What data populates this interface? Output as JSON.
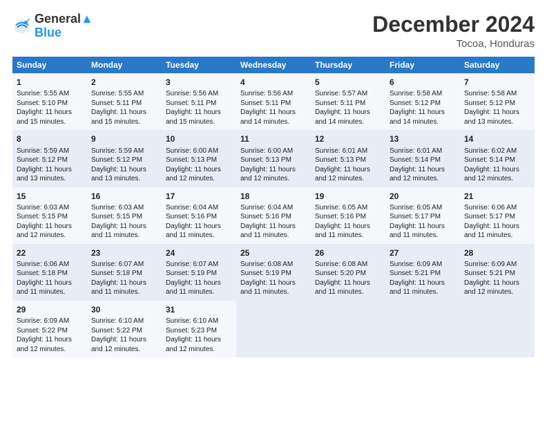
{
  "logo": {
    "line1": "General",
    "line2": "Blue"
  },
  "title": "December 2024",
  "subtitle": "Tocoa, Honduras",
  "columns": [
    "Sunday",
    "Monday",
    "Tuesday",
    "Wednesday",
    "Thursday",
    "Friday",
    "Saturday"
  ],
  "weeks": [
    [
      {
        "day": 1,
        "rise": "5:55 AM",
        "set": "5:10 PM",
        "daylight": "11 hours and 15 minutes."
      },
      {
        "day": 2,
        "rise": "5:55 AM",
        "set": "5:11 PM",
        "daylight": "11 hours and 15 minutes."
      },
      {
        "day": 3,
        "rise": "5:56 AM",
        "set": "5:11 PM",
        "daylight": "11 hours and 15 minutes."
      },
      {
        "day": 4,
        "rise": "5:56 AM",
        "set": "5:11 PM",
        "daylight": "11 hours and 14 minutes."
      },
      {
        "day": 5,
        "rise": "5:57 AM",
        "set": "5:11 PM",
        "daylight": "11 hours and 14 minutes."
      },
      {
        "day": 6,
        "rise": "5:58 AM",
        "set": "5:12 PM",
        "daylight": "11 hours and 14 minutes."
      },
      {
        "day": 7,
        "rise": "5:58 AM",
        "set": "5:12 PM",
        "daylight": "11 hours and 13 minutes."
      }
    ],
    [
      {
        "day": 8,
        "rise": "5:59 AM",
        "set": "5:12 PM",
        "daylight": "11 hours and 13 minutes."
      },
      {
        "day": 9,
        "rise": "5:59 AM",
        "set": "5:12 PM",
        "daylight": "11 hours and 13 minutes."
      },
      {
        "day": 10,
        "rise": "6:00 AM",
        "set": "5:13 PM",
        "daylight": "11 hours and 12 minutes."
      },
      {
        "day": 11,
        "rise": "6:00 AM",
        "set": "5:13 PM",
        "daylight": "11 hours and 12 minutes."
      },
      {
        "day": 12,
        "rise": "6:01 AM",
        "set": "5:13 PM",
        "daylight": "11 hours and 12 minutes."
      },
      {
        "day": 13,
        "rise": "6:01 AM",
        "set": "5:14 PM",
        "daylight": "11 hours and 12 minutes."
      },
      {
        "day": 14,
        "rise": "6:02 AM",
        "set": "5:14 PM",
        "daylight": "11 hours and 12 minutes."
      }
    ],
    [
      {
        "day": 15,
        "rise": "6:03 AM",
        "set": "5:15 PM",
        "daylight": "11 hours and 12 minutes."
      },
      {
        "day": 16,
        "rise": "6:03 AM",
        "set": "5:15 PM",
        "daylight": "11 hours and 11 minutes."
      },
      {
        "day": 17,
        "rise": "6:04 AM",
        "set": "5:16 PM",
        "daylight": "11 hours and 11 minutes."
      },
      {
        "day": 18,
        "rise": "6:04 AM",
        "set": "5:16 PM",
        "daylight": "11 hours and 11 minutes."
      },
      {
        "day": 19,
        "rise": "6:05 AM",
        "set": "5:16 PM",
        "daylight": "11 hours and 11 minutes."
      },
      {
        "day": 20,
        "rise": "6:05 AM",
        "set": "5:17 PM",
        "daylight": "11 hours and 11 minutes."
      },
      {
        "day": 21,
        "rise": "6:06 AM",
        "set": "5:17 PM",
        "daylight": "11 hours and 11 minutes."
      }
    ],
    [
      {
        "day": 22,
        "rise": "6:06 AM",
        "set": "5:18 PM",
        "daylight": "11 hours and 11 minutes."
      },
      {
        "day": 23,
        "rise": "6:07 AM",
        "set": "5:18 PM",
        "daylight": "11 hours and 11 minutes."
      },
      {
        "day": 24,
        "rise": "6:07 AM",
        "set": "5:19 PM",
        "daylight": "11 hours and 11 minutes."
      },
      {
        "day": 25,
        "rise": "6:08 AM",
        "set": "5:19 PM",
        "daylight": "11 hours and 11 minutes."
      },
      {
        "day": 26,
        "rise": "6:08 AM",
        "set": "5:20 PM",
        "daylight": "11 hours and 11 minutes."
      },
      {
        "day": 27,
        "rise": "6:09 AM",
        "set": "5:21 PM",
        "daylight": "11 hours and 11 minutes."
      },
      {
        "day": 28,
        "rise": "6:09 AM",
        "set": "5:21 PM",
        "daylight": "11 hours and 12 minutes."
      }
    ],
    [
      {
        "day": 29,
        "rise": "6:09 AM",
        "set": "5:22 PM",
        "daylight": "11 hours and 12 minutes."
      },
      {
        "day": 30,
        "rise": "6:10 AM",
        "set": "5:22 PM",
        "daylight": "11 hours and 12 minutes."
      },
      {
        "day": 31,
        "rise": "6:10 AM",
        "set": "5:23 PM",
        "daylight": "11 hours and 12 minutes."
      },
      null,
      null,
      null,
      null
    ]
  ]
}
